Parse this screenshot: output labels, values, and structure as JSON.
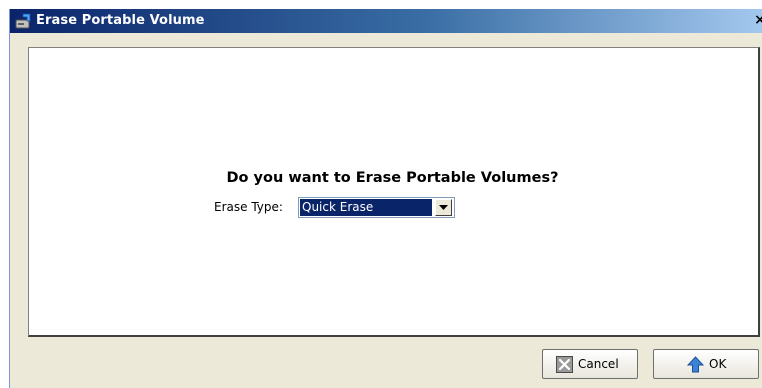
{
  "window": {
    "title": "Erase Portable Volume",
    "close_glyph": "×"
  },
  "dialog": {
    "question": "Do you want to Erase Portable Volumes?",
    "erase_type": {
      "label": "Erase Type:",
      "selected_value": "Quick Erase"
    }
  },
  "buttons": {
    "cancel_label": "Cancel",
    "ok_label": "OK"
  },
  "icons": {
    "title": "volume-icon",
    "cancel": "cancel-x-icon",
    "ok": "up-arrow-icon",
    "dropdown": "chevron-down-icon"
  },
  "colors": {
    "titlebar_start": "#0a246a",
    "titlebar_end": "#a6caf0",
    "selection": "#0a246a",
    "dialog_bg": "#ece9d8"
  }
}
